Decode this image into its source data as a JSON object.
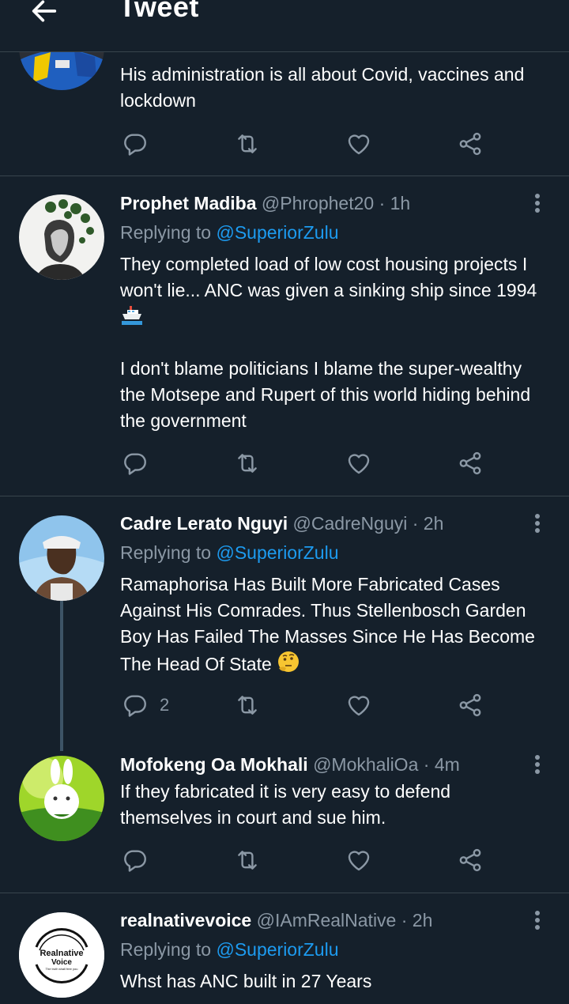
{
  "header": {
    "title": "Tweet"
  },
  "colors": {
    "background": "#15202b",
    "divider": "#38444d",
    "muted": "#8b98a5",
    "link": "#1d9bf0"
  },
  "tweets": [
    {
      "text": "His administration is all about Covid, vaccines and lockdown"
    },
    {
      "name": "Prophet Madiba",
      "handle": "@Phrophet20",
      "time": "· 1h",
      "replying_prefix": "Replying to",
      "replying_to": "@SuperiorZulu",
      "text_p1": "They completed load of low cost housing projects I won't lie... ANC was given a sinking ship since 1994",
      "text_p2": "I don't blame politicians I blame the super-wealthy the Motsepe and Rupert of this world hiding behind the government"
    },
    {
      "name": "Cadre Lerato Nguyi",
      "handle": "@CadreNguyi",
      "time": "· 2h",
      "replying_prefix": "Replying to",
      "replying_to": "@SuperiorZulu",
      "text": "Ramaphorisa Has Built More Fabricated Cases Against His Comrades. Thus Stellenbosch Garden Boy Has Failed The Masses Since He Has Become The Head Of State",
      "reply_count": "2"
    },
    {
      "name": "Mofokeng Oa Mokhali",
      "handle": "@MokhaliOa",
      "time": "· 4m",
      "text": "If they fabricated it is very easy to defend themselves in court and sue him."
    },
    {
      "name": "realnativevoice",
      "handle": "@IAmRealNative",
      "time": "· 2h",
      "replying_prefix": "Replying to",
      "replying_to": "@SuperiorZulu",
      "text": "Whst has ANC built in 27 Years",
      "avatar_logo_line1": "Realnative",
      "avatar_logo_line2": "Voice",
      "avatar_logo_tagline": "The truth shall free you"
    }
  ]
}
